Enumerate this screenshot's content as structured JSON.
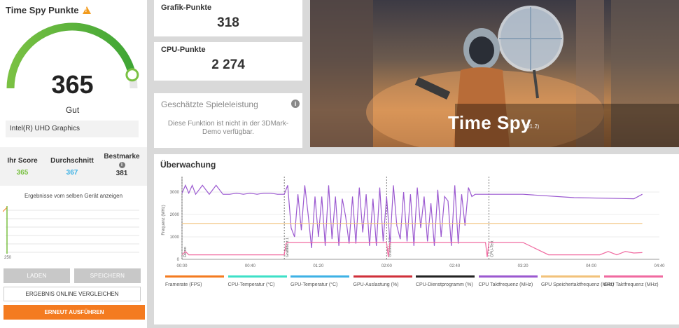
{
  "left_panel": {
    "title": "Time Spy Punkte",
    "score": "365",
    "rating": "Gut",
    "gauge_fraction": 0.93,
    "gpu_name": "Intel(R) UHD Graphics",
    "your_score_label": "Ihr Score",
    "your_score_value": "365",
    "average_label": "Durchschnitt",
    "average_value": "367",
    "best_label": "Bestmarke",
    "best_value": "381",
    "same_device_text": "Ergebnisse vom selben Gerät anzeigen",
    "mini_axis_label": "250",
    "load_label": "LADEN",
    "save_label": "SPEICHERN",
    "compare_label": "ERGEBNIS ONLINE VERGLEICHEN",
    "run_label": "ERNEUT AUSFÜHREN"
  },
  "cards": {
    "gpu_label": "Grafik-Punkte",
    "gpu_value": "318",
    "cpu_label": "CPU-Punkte",
    "cpu_value": "2 274",
    "game_title": "Geschätzte Spieleleistung",
    "game_text": "Diese Funktion ist nicht in der 3DMark-Demo verfügbar."
  },
  "hero": {
    "title": "Time Spy",
    "version": "(v1.2)"
  },
  "monitoring": {
    "title": "Überwachung",
    "y_axis_label": "Frequenz (MHz)",
    "y_ticks": [
      "3000",
      "2000",
      "1000",
      "0"
    ],
    "x_ticks": [
      "00:00",
      "00:40",
      "01:20",
      "02:00",
      "02:40",
      "03:20",
      "04:00",
      "04:40"
    ],
    "phases": [
      "Demo",
      "Grafiktest 1",
      "Grafiktest 2",
      "CPU-Test"
    ],
    "legend": [
      {
        "label": "Framerate (FPS)",
        "color": "#f47b20"
      },
      {
        "label": "CPU-Temperatur (°C)",
        "color": "#3ee0c8"
      },
      {
        "label": "GPU-Temperatur (°C)",
        "color": "#3eb2e5"
      },
      {
        "label": "GPU-Auslastung (%)",
        "color": "#d0303a"
      },
      {
        "label": "CPU-Dienstprogramm (%)",
        "color": "#222222"
      },
      {
        "label": "CPU Taktfrequenz (MHz)",
        "color": "#9b59d0"
      },
      {
        "label": "GPU Speichertaktfrequenz (MHz)",
        "color": "#f2c27a"
      },
      {
        "label": "GPU Taktfrequenz (MHz)",
        "color": "#f06aa0"
      }
    ],
    "chart_data": {
      "type": "line",
      "ylabel": "Frequenz (MHz)",
      "ylim": [
        0,
        3500
      ],
      "xlim": [
        0,
        280
      ],
      "series": [
        {
          "name": "CPU Taktfrequenz (MHz)",
          "color": "#9b59d0",
          "x": [
            0,
            2,
            4,
            6,
            8,
            12,
            16,
            20,
            24,
            28,
            32,
            36,
            40,
            44,
            48,
            52,
            56,
            60,
            62,
            64,
            66,
            68,
            70,
            72,
            74,
            76,
            78,
            80,
            82,
            84,
            86,
            88,
            90,
            92,
            94,
            96,
            98,
            100,
            102,
            104,
            106,
            108,
            110,
            112,
            114,
            116,
            118,
            120,
            122,
            124,
            126,
            128,
            130,
            132,
            134,
            136,
            138,
            140,
            142,
            144,
            146,
            148,
            150,
            152,
            154,
            156,
            158,
            160,
            162,
            164,
            166,
            168,
            170,
            172,
            174,
            176,
            178,
            180,
            200,
            230,
            265,
            270
          ],
          "y": [
            2950,
            3300,
            2950,
            3300,
            2900,
            3300,
            2900,
            3300,
            2900,
            2900,
            2950,
            2900,
            2950,
            2900,
            2950,
            2950,
            2900,
            2900,
            3300,
            1400,
            1000,
            2900,
            1300,
            3300,
            2000,
            500,
            2800,
            1000,
            2800,
            600,
            3300,
            900,
            2800,
            600,
            2700,
            1900,
            700,
            2800,
            700,
            3200,
            1200,
            2900,
            600,
            2700,
            600,
            3200,
            800,
            2800,
            700,
            3300,
            1500,
            900,
            3000,
            800,
            2900,
            600,
            3200,
            1400,
            2800,
            800,
            2500,
            600,
            3100,
            1000,
            2800,
            2600,
            600,
            3300,
            700,
            2900,
            1500,
            3200,
            2800,
            2900,
            2900,
            2900,
            2900,
            2900,
            2900,
            2750,
            2700,
            2900
          ]
        },
        {
          "name": "GPU Speichertaktfrequenz (MHz)",
          "color": "#f2c27a",
          "x": [
            0,
            270
          ],
          "y": [
            1600,
            1600
          ]
        },
        {
          "name": "GPU Taktfrequenz (MHz)",
          "color": "#f06aa0",
          "x": [
            0,
            2,
            4,
            6,
            60,
            61,
            62,
            120,
            121,
            122,
            178,
            179,
            180,
            200,
            215,
            240,
            245,
            250,
            255,
            260,
            265,
            270
          ],
          "y": [
            200,
            350,
            200,
            200,
            200,
            700,
            750,
            750,
            100,
            750,
            750,
            100,
            750,
            750,
            200,
            200,
            200,
            350,
            200,
            350,
            280,
            300
          ]
        }
      ]
    }
  }
}
